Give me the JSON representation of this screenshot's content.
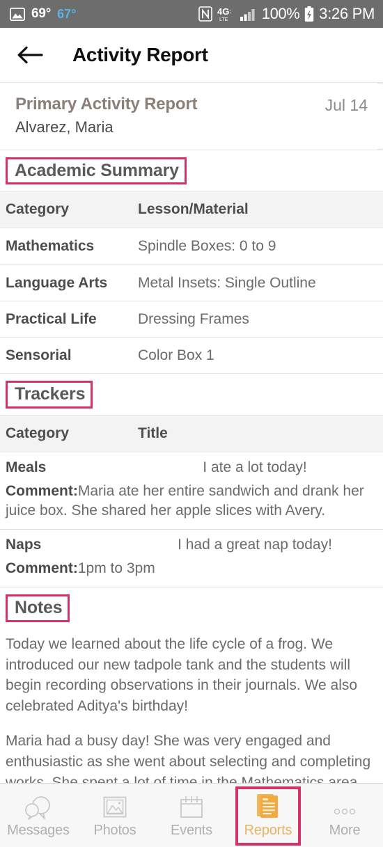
{
  "statusbar": {
    "photo_icon": "image-icon",
    "temp_primary": "69°",
    "temp_secondary": "67°",
    "nfc_icon": "nfc-icon",
    "network_label": "4G LTE",
    "signal_icon": "signal-bars-icon",
    "battery_percent": "100%",
    "battery_icon": "battery-charging-icon",
    "time": "3:26 PM",
    "bg_color": "#6d6d6d"
  },
  "appbar": {
    "back_icon": "back-arrow-icon",
    "title": "Activity Report"
  },
  "report_header": {
    "title": "Primary Activity Report",
    "student": "Alvarez, Maria",
    "date": "Jul 14",
    "title_color": "#8b7f77"
  },
  "annotation": {
    "color": "#d1336b"
  },
  "sections": {
    "academic": {
      "heading": "Academic Summary",
      "columns": [
        "Category",
        "Lesson/Material"
      ],
      "rows": [
        {
          "category": "Mathematics",
          "lesson": "Spindle Boxes: 0 to 9"
        },
        {
          "category": "Language Arts",
          "lesson": "Metal Insets:  Single Outline"
        },
        {
          "category": "Practical Life",
          "lesson": "Dressing Frames"
        },
        {
          "category": "Sensorial",
          "lesson": "Color Box 1"
        }
      ]
    },
    "trackers": {
      "heading": "Trackers",
      "columns": [
        "Category",
        "Title"
      ],
      "rows": [
        {
          "category": "Meals",
          "title": "I ate a lot today!",
          "comment_label": "Comment:",
          "comment": "Maria ate her entire sandwich and drank her juice box. She shared her apple slices with Avery."
        },
        {
          "category": "Naps",
          "title": "I had a great nap today!",
          "comment_label": "Comment:",
          "comment": "1pm to 3pm"
        }
      ]
    },
    "notes": {
      "heading": "Notes",
      "paragraphs": [
        "Today we learned about the life cycle of a frog. We introduced our new tadpole tank and the students will begin recording observations in their journals. We also celebrated Aditya's birthday!",
        "Maria had a busy day! She was very engaged and enthusiastic as she went about selecting and completing works. She spent a lot of time in the Mathematics area."
      ]
    }
  },
  "bottom_nav": {
    "items": [
      {
        "label": "Messages",
        "icon": "chat-bubbles-icon",
        "active": false
      },
      {
        "label": "Photos",
        "icon": "image-icon",
        "active": false
      },
      {
        "label": "Events",
        "icon": "calendar-icon",
        "active": false
      },
      {
        "label": "Reports",
        "icon": "document-icon",
        "active": true
      },
      {
        "label": "More",
        "icon": "ellipsis-icon",
        "active": false
      }
    ],
    "active_color": "#e6b463",
    "inactive_color": "#b0b0b0"
  }
}
